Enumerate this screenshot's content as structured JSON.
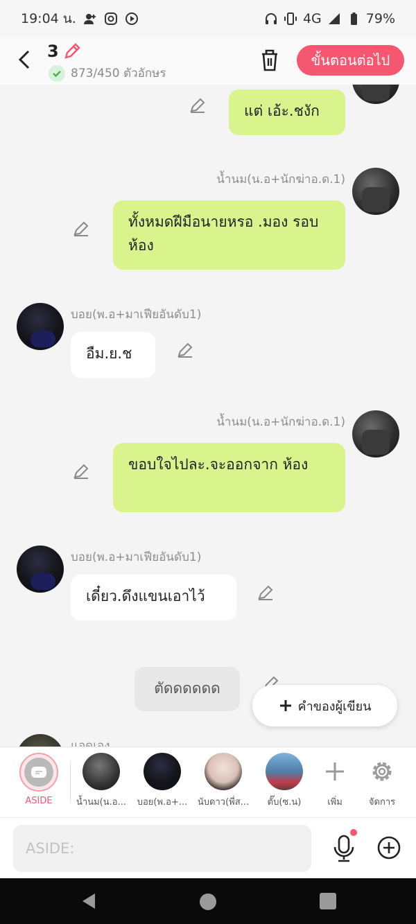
{
  "status": {
    "time": "19:04 น.",
    "network": "4G",
    "battery": "79%"
  },
  "header": {
    "episode_number": "3",
    "char_count": "873/450 ตัวอักษร",
    "next_label": "ขั้นตอนต่อไป"
  },
  "messages": [
    {
      "sender": "",
      "text": "แต่ เอ้ะ.ชงัก"
    },
    {
      "sender": "น้ำนม(น.อ+นักฆ่าอ.ด.1)",
      "text": "ทั้งหมดฝีมือนายหรอ .มอง รอบห้อง"
    },
    {
      "sender": "บอย(พ.อ+มาเฟียอันดับ1)",
      "text": "อืม.ย.ช"
    },
    {
      "sender": "น้ำนม(น.อ+นักฆ่าอ.ด.1)",
      "text": "ขอบใจไปละ.จะออกจาก ห้อง"
    },
    {
      "sender": "บอย(พ.อ+มาเฟียอันดับ1)",
      "text": "เดี๋ยว.ดึงแขนเอาไว้"
    },
    {
      "sender": "",
      "text": "ตัดดดดดด"
    },
    {
      "sender": "แอดเอง",
      "text": ""
    }
  ],
  "author_button": "คำของผู้เขียน",
  "characters": [
    {
      "label": "ASIDE"
    },
    {
      "label": "น้ำนม(น.อ..."
    },
    {
      "label": "บอย(พ.อ+..."
    },
    {
      "label": "นับดาว(พี่ส..."
    },
    {
      "label": "ตั๊บ(ซ.น)"
    },
    {
      "label": "เพิ่ม"
    },
    {
      "label": "จัดการ"
    }
  ],
  "input": {
    "placeholder": "ASIDE:"
  },
  "colors": {
    "accent": "#f4576f",
    "my_bubble": "#d9f48d",
    "other_bubble": "#ffffff"
  }
}
